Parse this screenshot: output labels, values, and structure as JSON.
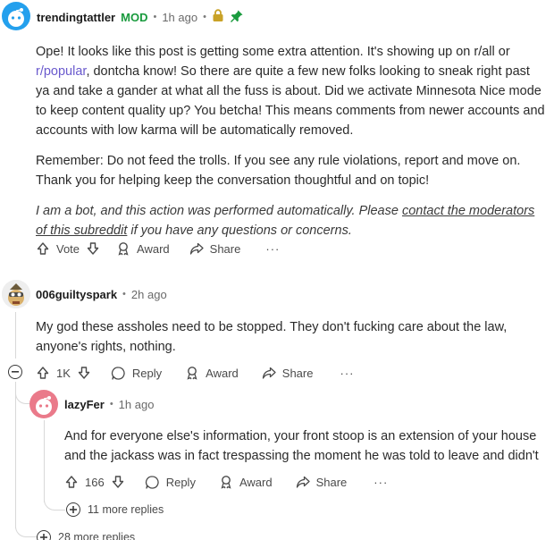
{
  "comments": {
    "bot": {
      "author": "trendingtattler",
      "mod_badge": "MOD",
      "time": "1h ago",
      "paragraph1_a": "Ope! It looks like this post is getting some extra attention. It's showing up on r/all or ",
      "paragraph1_link": "r/popular",
      "paragraph1_b": ", dontcha know! So there are quite a few new folks looking to sneak right past ya and take a gander at what all the fuss is about. Did we activate Minnesota Nice mode to keep content quality up? You betcha! This means comments from newer accounts and accounts with low karma will be automatically removed.",
      "paragraph2": "Remember: Do not feed the trolls. If you see any rule violations, report and move on. Thank you for helping keep the conversation thoughtful and on topic!",
      "paragraph3_a": "I am a bot, and this action was performed automatically. Please ",
      "paragraph3_link": "contact the moderators of this subreddit",
      "paragraph3_b": " if you have any questions or concerns.",
      "vote_label": "Vote",
      "award_label": "Award",
      "share_label": "Share",
      "more_label": "···"
    },
    "spark": {
      "author": "006guiltyspark",
      "time": "2h ago",
      "text": "My god these assholes need to be stopped. They don't fucking care about the law, anyone's rights, nothing.",
      "votes": "1K",
      "reply_label": "Reply",
      "award_label": "Award",
      "share_label": "Share",
      "more_label": "···"
    },
    "lazy": {
      "author": "lazyFer",
      "time": "1h ago",
      "text": "And for everyone else's information, your front stoop is an extension of your house and the jackass was in fact trespassing the moment he was told to leave and didn't",
      "votes": "166",
      "reply_label": "Reply",
      "award_label": "Award",
      "share_label": "Share",
      "more_label": "···",
      "more_replies": "11 more replies"
    },
    "outer_more_replies": "28 more replies"
  },
  "separator": "•",
  "icons": [
    "lock-icon",
    "pin-icon",
    "upvote-icon",
    "downvote-icon",
    "award-icon",
    "share-icon",
    "reply-icon",
    "collapse-icon",
    "expand-icon"
  ],
  "colors": {
    "mod": "#1a9b3e",
    "link": "#6a5acd",
    "bot_avatar": "#24a0ed",
    "lazy_avatar": "#ea7a8a",
    "lock": "#c9a227",
    "pin": "#1a9b3e"
  }
}
